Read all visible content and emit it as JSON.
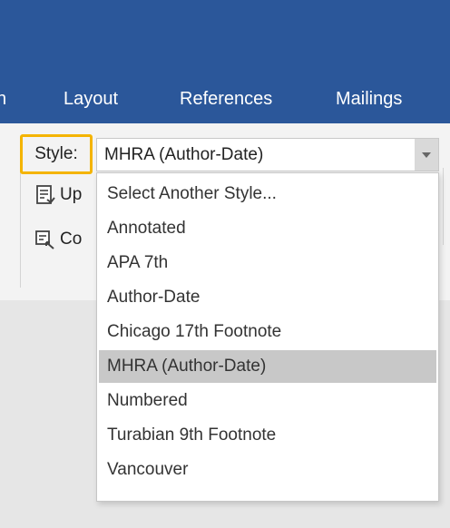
{
  "ribbon_tabs": [
    "n",
    "Layout",
    "References",
    "Mailings"
  ],
  "style_picker": {
    "label": "Style:",
    "selected": "MHRA (Author-Date)"
  },
  "ribbon_commands": [
    "Up",
    "Co"
  ],
  "style_menu": {
    "items": [
      "Select Another Style...",
      "Annotated",
      "APA 7th",
      "Author-Date",
      "Chicago 17th Footnote",
      "MHRA (Author-Date)",
      "Numbered",
      "Turabian 9th Footnote",
      "Vancouver"
    ],
    "selected_index": 5
  },
  "colors": {
    "title_bar": "#2b579a",
    "highlight_border": "#f4b400",
    "selected_item": "#c8c8c8"
  }
}
